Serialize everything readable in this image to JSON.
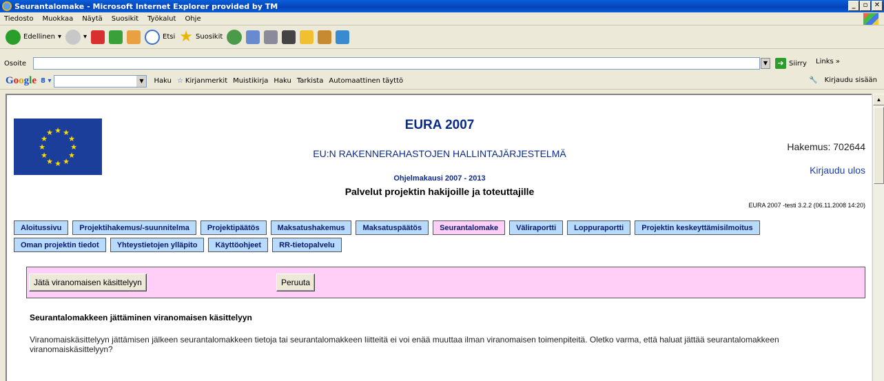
{
  "window": {
    "title": "Seurantalomake - Microsoft Internet Explorer provided by TM"
  },
  "menu": [
    "Tiedosto",
    "Muokkaa",
    "Näytä",
    "Suosikit",
    "Työkalut",
    "Ohje"
  ],
  "toolbar": {
    "back": "Edellinen",
    "search": "Etsi",
    "favorites": "Suosikit"
  },
  "address": {
    "label": "Osoite",
    "value": "",
    "go": "Siirry",
    "links": "Links"
  },
  "google": {
    "search_label": "Haku",
    "bookmarks": "Kirjanmerkit",
    "notebook": "Muistikirja",
    "search2": "Haku",
    "spellcheck": "Tarkista",
    "autofill": "Automaattinen täyttö",
    "signin": "Kirjaudu sisään"
  },
  "header": {
    "title": "EURA 2007",
    "subtitle": "EU:N RAKENNERAHASTOJEN HALLINTAJÄRJESTELMÄ",
    "period": "Ohjelmakausi 2007 - 2013",
    "services": "Palvelut projektin hakijoille ja toteuttajille",
    "application": "Hakemus: 702644",
    "logout": "Kirjaudu ulos",
    "version": "EURA 2007 -testi 3.2.2 (06.11.2008 14:20)"
  },
  "nav_row1": [
    "Aloitussivu",
    "Projektihakemus/-suunnitelma",
    "Projektipäätös",
    "Maksatushakemus",
    "Maksatuspäätös",
    "Seurantalomake",
    "Väliraportti",
    "Loppuraportti",
    "Projektin keskeyttämisilmoitus"
  ],
  "nav_row2": [
    "Oman projektin tiedot",
    "Yhteystietojen ylläpito",
    "Käyttöohjeet",
    "RR-tietopalvelu"
  ],
  "actions": {
    "submit": "Jätä viranomaisen käsittelyyn",
    "cancel": "Peruuta"
  },
  "content": {
    "heading": "Seurantalomakkeen jättäminen viranomaisen käsittelyyn",
    "text": "Viranomaiskäsittelyyn jättämisen jälkeen seurantalomakkeen tietoja tai seurantalomakkeen liitteitä ei voi enää muuttaa ilman viranomaisen toimenpiteitä. Oletko varma, että haluat jättää seurantalomakkeen viranomaiskäsittelyyn?"
  }
}
